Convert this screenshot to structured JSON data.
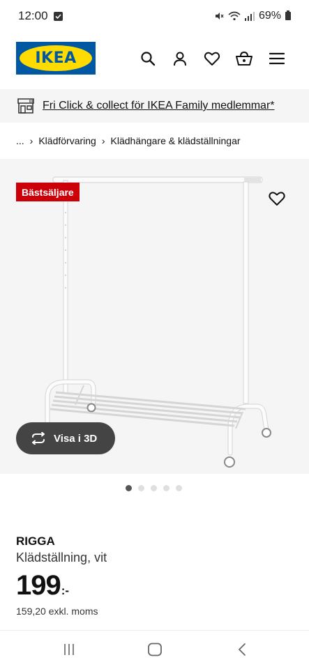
{
  "status_bar": {
    "time": "12:00",
    "battery": "69%"
  },
  "header": {
    "logo_text": "IKEA",
    "icons": [
      "search-icon",
      "user-icon",
      "heart-icon",
      "basket-icon",
      "menu-icon"
    ]
  },
  "promo": {
    "text": "Fri Click & collect för IKEA Family medlemmar*",
    "icon": "store-icon"
  },
  "breadcrumb": {
    "ellipsis": "...",
    "items": [
      "Klädförvaring",
      "Klädhängare & klädställningar"
    ],
    "separator": "›"
  },
  "product": {
    "badge": "Bästsäljare",
    "view_3d_label": "Visa i 3D",
    "name": "RIGGA",
    "description": "Klädställning, vit",
    "price": "199",
    "price_suffix": ":-",
    "price_excl": "159,20 exkl. moms"
  },
  "gallery": {
    "total_images": 5,
    "active_index": 0
  },
  "colors": {
    "ikea_blue": "#0058a3",
    "ikea_yellow": "#ffdb00",
    "badge_red": "#cc0008",
    "button_dark": "#444444"
  }
}
